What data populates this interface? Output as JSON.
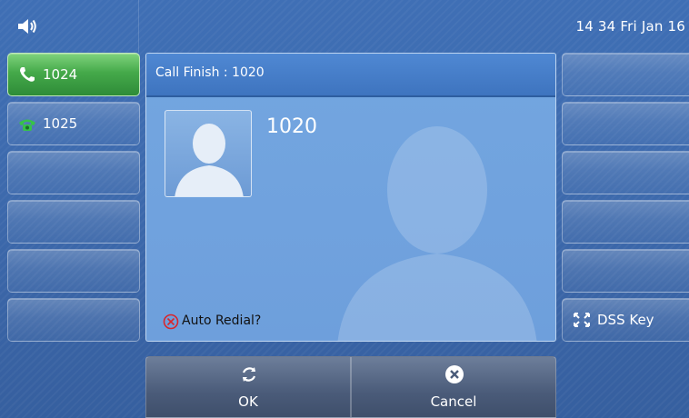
{
  "status_bar": {
    "volume_icon": "speaker-icon",
    "datetime": "14 34 Fri Jan 16"
  },
  "line_keys": [
    {
      "label": "1024",
      "icon": "phone-handset-icon",
      "active": true,
      "color": "#45a94a"
    },
    {
      "label": "1025",
      "icon": "phone-icon",
      "active": false
    },
    {
      "label": ""
    },
    {
      "label": ""
    },
    {
      "label": ""
    },
    {
      "label": ""
    }
  ],
  "dss_keys": [
    {
      "label": ""
    },
    {
      "label": ""
    },
    {
      "label": ""
    },
    {
      "label": ""
    },
    {
      "label": ""
    },
    {
      "label": "DSS Key",
      "icon": "expand-icon"
    }
  ],
  "call_panel": {
    "title": "Call Finish : 1020",
    "caller_number": "1020",
    "auto_redial_label": "Auto Redial?",
    "auto_redial_icon": "circle-x-icon"
  },
  "softkeys": {
    "ok_label": "OK",
    "ok_icon": "refresh-icon",
    "cancel_label": "Cancel",
    "cancel_icon": "close-circle-icon"
  }
}
